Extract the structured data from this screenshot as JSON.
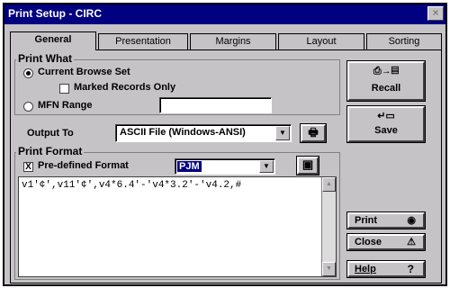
{
  "window": {
    "title": "Print Setup - CIRC",
    "close_glyph": "×"
  },
  "tabs": [
    {
      "label": "General",
      "active": true
    },
    {
      "label": "Presentation"
    },
    {
      "label": "Margins"
    },
    {
      "label": "Layout"
    },
    {
      "label": "Sorting"
    }
  ],
  "print_what": {
    "title": "Print What",
    "current_browse_label": "Current Browse Set",
    "current_browse_selected": true,
    "marked_records_label": "Marked Records Only",
    "marked_records_checked": false,
    "mfn_range_label": "MFN Range",
    "mfn_range_value": ""
  },
  "output_to": {
    "label": "Output To",
    "value": "ASCII File (Windows-ANSI)"
  },
  "print_format": {
    "title": "Print Format",
    "predefined_label": "Pre-defined Format",
    "predefined_checked": true,
    "predefined_check_glyph": "X",
    "format_value": "PJM",
    "format_text": "v1'¢',v11'¢',v4*6.4'-'v4*3.2'-'v4.2,#"
  },
  "buttons": {
    "recall": "Recall",
    "save": "Save",
    "print": "Print",
    "close": "Close",
    "help": "Help"
  },
  "icons": {
    "recall_icon": "⎙→▤",
    "save_icon": "↵▭",
    "printer_icon": "🖶",
    "floppy_icon": "▣",
    "print_icon": "◉",
    "close_icon": "⚠",
    "help_icon": "?",
    "dropdown_arrow": "▼",
    "scroll_up": "▲",
    "scroll_down": "▼"
  }
}
